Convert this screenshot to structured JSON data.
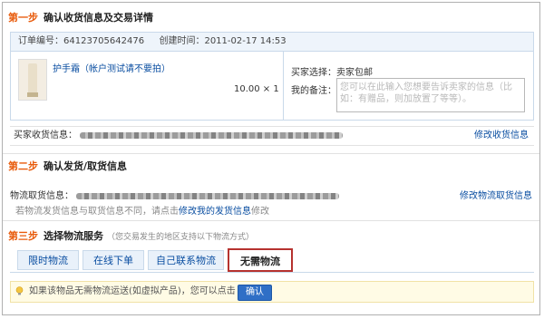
{
  "step1": {
    "no": "第一步",
    "title": "确认收货信息及交易详情"
  },
  "order": {
    "number_label": "订单编号：",
    "number": "64123705642476",
    "created_label": "创建时间：",
    "created": "2011-02-17 14:53"
  },
  "product": {
    "name": "护手霜（帐户测试请不要拍）",
    "price_qty": "10.00 × 1"
  },
  "buyer": {
    "ship_label": "买家选择：",
    "ship_value": "卖家包邮",
    "note_label": "我的备注：",
    "note_placeholder": "您可以在此输入您想要告诉卖家的信息（比如：有赠品，则加放置了等等）。"
  },
  "address": {
    "label": "买家收货信息：",
    "modify_link": "修改收货信息"
  },
  "step2": {
    "no": "第二步",
    "title": "确认发货/取货信息"
  },
  "logistics": {
    "label": "物流取货信息：",
    "modify_link": "修改物流取货信息",
    "hint_prefix": "若物流发货信息与取货信息不同，请点击",
    "hint_link": "修改我的发货信息",
    "hint_suffix": "修改"
  },
  "step3": {
    "no": "第三步",
    "title": "选择物流服务",
    "note": "（您交易发生的地区支持以下物流方式）"
  },
  "tabs": [
    "限时物流",
    "在线下单",
    "自己联系物流",
    "无需物流"
  ],
  "confirm": {
    "text": "如果该物品无需物流运送(如虚拟产品)，您可以点击",
    "button": "确认"
  },
  "colors": {
    "step_no": "#e85b0c",
    "link": "#0a4ea1",
    "active_tab_border": "#b6322f",
    "button": "#2f6fc6"
  }
}
